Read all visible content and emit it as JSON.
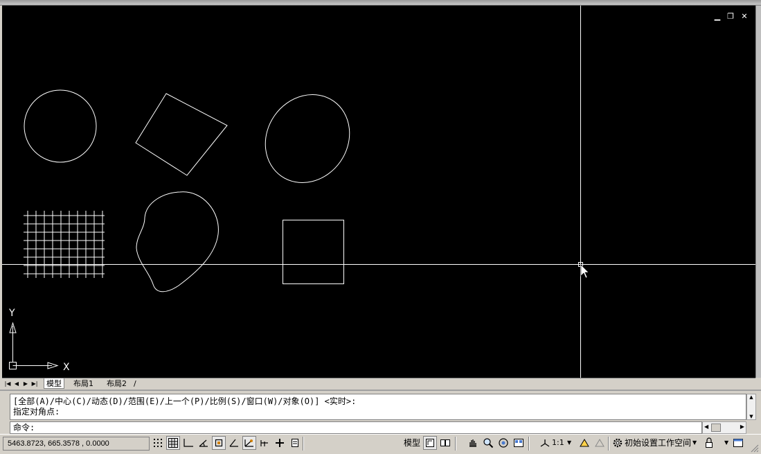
{
  "window_controls": {
    "minimize": "▁",
    "restore": "❐",
    "close": "✕"
  },
  "ucs": {
    "x_label": "X",
    "y_label": "Y"
  },
  "layout_tabs": {
    "items": [
      {
        "label": "模型",
        "active": true
      },
      {
        "label": "布局1",
        "active": false
      },
      {
        "label": "布局2",
        "active": false
      }
    ],
    "separator": "/"
  },
  "command": {
    "history": [
      "[全部(A)/中心(C)/动态(D)/范围(E)/上一个(P)/比例(S)/窗口(W)/对象(O)] <实时>:",
      "指定对角点:"
    ],
    "prompt": "命令:"
  },
  "status": {
    "coordinates": "5463.8723, 665.3578 , 0.0000",
    "model_label": "模型",
    "annotation_scale": "1:1",
    "workspace": "初始设置工作空间"
  },
  "colors": {
    "canvas_bg": "#000000",
    "geometry": "#ffffff",
    "chrome": "#d4d0c8"
  }
}
